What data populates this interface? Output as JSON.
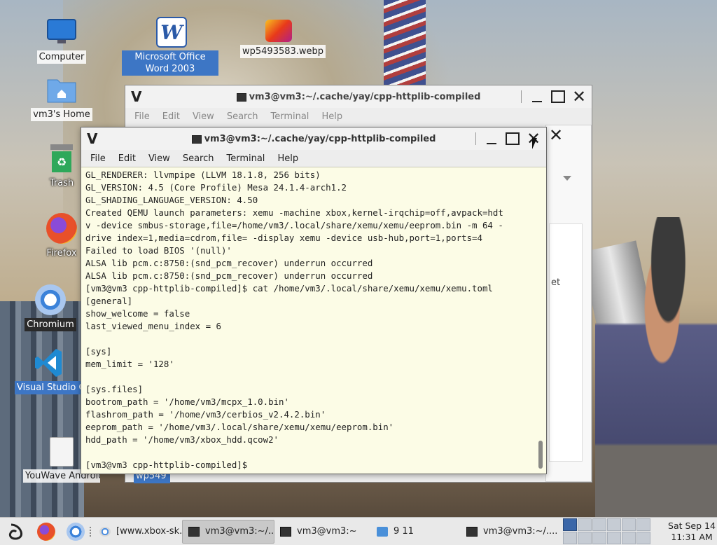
{
  "desktop": {
    "icons": [
      {
        "label": "Computer",
        "icon": "monitor-icon"
      },
      {
        "label": "Microsoft Office Word 2003",
        "icon": "word-icon"
      },
      {
        "label": "wp5493583.webp",
        "icon": "image-file-icon"
      },
      {
        "label": "vm3's Home",
        "icon": "home-folder-icon"
      },
      {
        "label": "Trash",
        "icon": "trash-icon"
      },
      {
        "label": "Firefox",
        "icon": "firefox-icon"
      },
      {
        "label": "Chromium",
        "icon": "chromium-icon"
      },
      {
        "label": "Visual Studio Co",
        "icon": "vscode-icon"
      },
      {
        "label": "YouWave Android",
        "icon": "document-icon"
      }
    ],
    "partial_labels": {
      "wp549": "wp549",
      "et": "et"
    }
  },
  "back_window": {
    "logo": "V",
    "title": "vm3@vm3:~/.cache/yay/cpp-httplib-compiled",
    "menu": [
      "File",
      "Edit",
      "View",
      "Search",
      "Terminal",
      "Help"
    ]
  },
  "front_window": {
    "logo": "V",
    "title": "vm3@vm3:~/.cache/yay/cpp-httplib-compiled",
    "menu": [
      "File",
      "Edit",
      "View",
      "Search",
      "Terminal",
      "Help"
    ],
    "terminal_lines": [
      "GL_RENDERER: llvmpipe (LLVM 18.1.8, 256 bits)",
      "GL_VERSION: 4.5 (Core Profile) Mesa 24.1.4-arch1.2",
      "GL_SHADING_LANGUAGE_VERSION: 4.50",
      "Created QEMU launch parameters: xemu -machine xbox,kernel-irqchip=off,avpack=hdt",
      "v -device smbus-storage,file=/home/vm3/.local/share/xemu/xemu/eeprom.bin -m 64 -",
      "drive index=1,media=cdrom,file= -display xemu -device usb-hub,port=1,ports=4",
      "Failed to load BIOS '(null)'",
      "ALSA lib pcm.c:8750:(snd_pcm_recover) underrun occurred",
      "ALSA lib pcm.c:8750:(snd_pcm_recover) underrun occurred",
      "[vm3@vm3 cpp-httplib-compiled]$ cat /home/vm3/.local/share/xemu/xemu/xemu.toml",
      "[general]",
      "show_welcome = false",
      "last_viewed_menu_index = 6",
      "",
      "[sys]",
      "mem_limit = '128'",
      "",
      "[sys.files]",
      "bootrom_path = '/home/vm3/mcpx_1.0.bin'",
      "flashrom_path = '/home/vm3/cerbios_v2.4.2.bin'",
      "eeprom_path = '/home/vm3/.local/share/xemu/xemu/eeprom.bin'",
      "hdd_path = '/home/vm3/xbox_hdd.qcow2'",
      "",
      "[vm3@vm3 cpp-httplib-compiled]$"
    ]
  },
  "taskbar": {
    "tasks": [
      {
        "label": "[www.xbox-sk...",
        "icon": "chromium-icon",
        "active": false
      },
      {
        "label": "vm3@vm3:~/....",
        "icon": "terminal-icon",
        "active": true
      },
      {
        "label": "vm3@vm3:~",
        "icon": "terminal-icon",
        "active": false
      },
      {
        "label": "9 11",
        "icon": "folder-icon",
        "active": false
      },
      {
        "label": "vm3@vm3:~/....",
        "icon": "terminal-icon",
        "active": false
      }
    ],
    "clock_day": "Sat Sep 14",
    "clock_time": "11:31 AM"
  }
}
